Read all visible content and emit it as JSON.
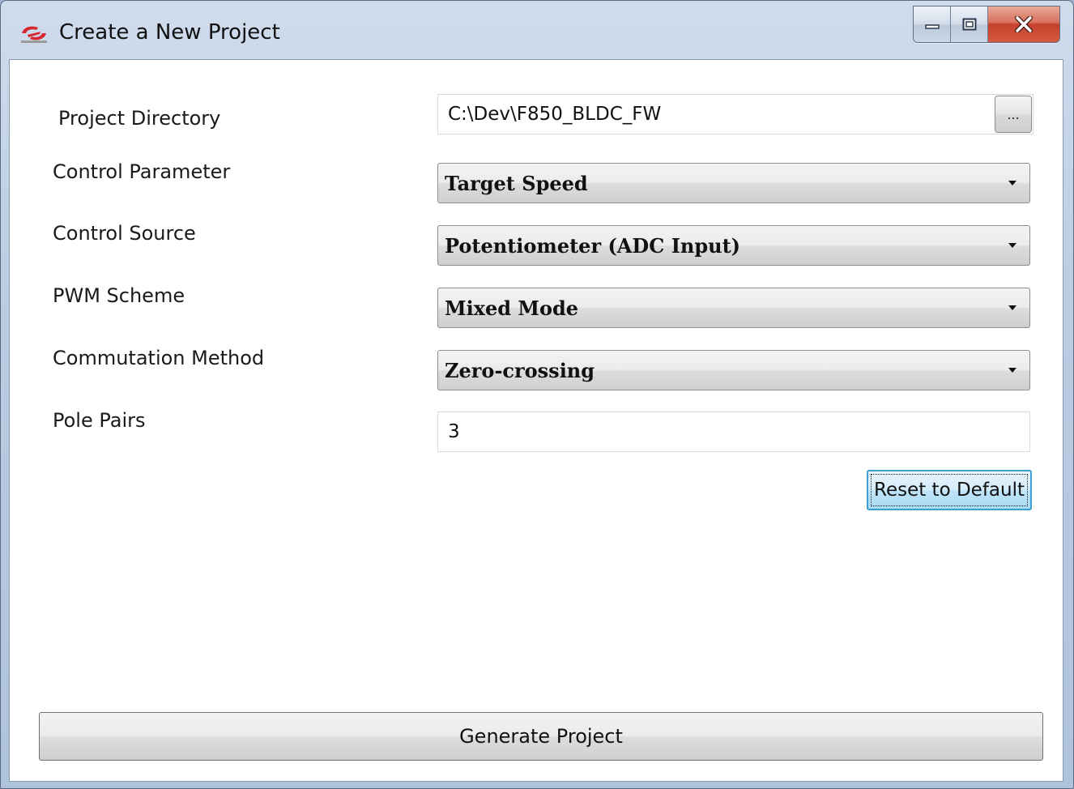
{
  "window": {
    "title": "Create a New Project",
    "app_icon": "silicon-labs-logo-icon",
    "controls": {
      "minimize_icon": "minimize-icon",
      "maximize_icon": "maximize-icon",
      "close_icon": "close-icon"
    }
  },
  "form": {
    "project_directory": {
      "label": "Project Directory",
      "value": "C:\\Dev\\F850_BLDC_FW",
      "browse_label": "..."
    },
    "control_parameter": {
      "label": "Control Parameter",
      "value": "Target Speed"
    },
    "control_source": {
      "label": "Control Source",
      "value": "Potentiometer (ADC Input)"
    },
    "pwm_scheme": {
      "label": "PWM Scheme",
      "value": "Mixed Mode"
    },
    "commutation_method": {
      "label": "Commutation Method",
      "value": "Zero-crossing"
    },
    "pole_pairs": {
      "label": "Pole Pairs",
      "value": "3"
    },
    "reset_label": "Reset to Default",
    "generate_label": "Generate Project"
  },
  "colors": {
    "window_frame": "#b9cce2",
    "close_button": "#c5412b",
    "focus_button_border": "#3c9fd0"
  }
}
